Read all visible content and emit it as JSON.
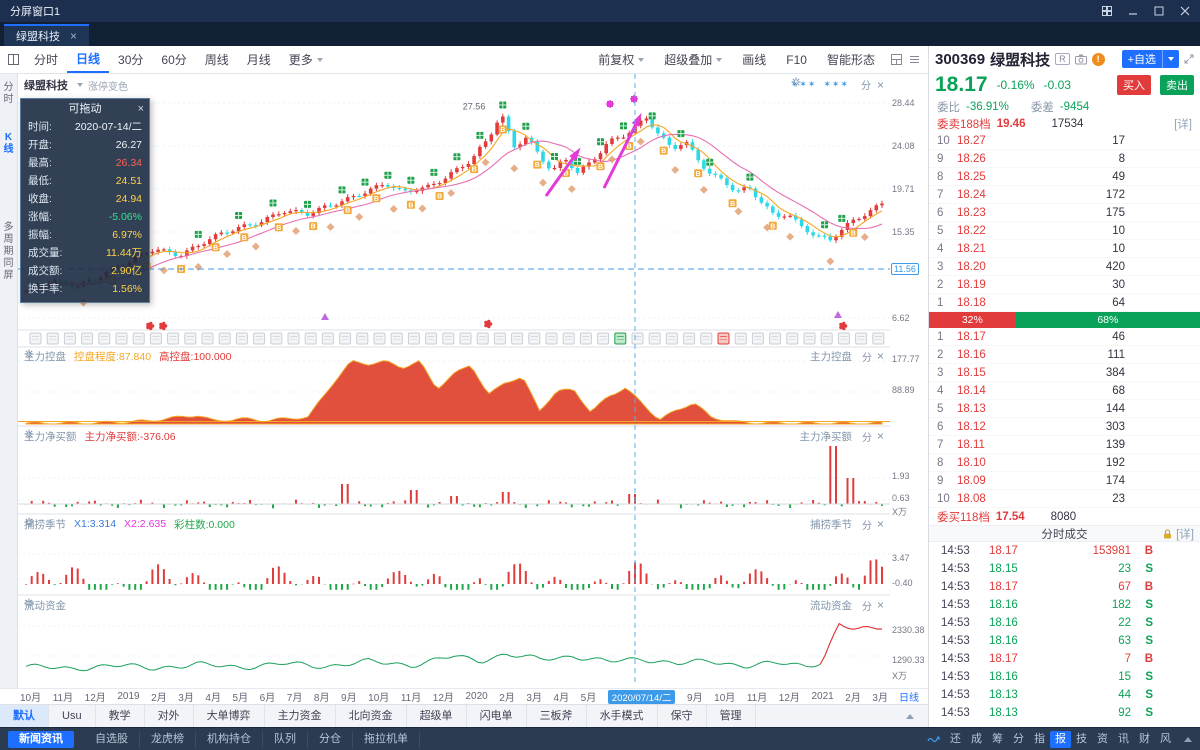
{
  "window": {
    "title": "分屏窗口1"
  },
  "doc_tab": {
    "label": "绿盟科技"
  },
  "ui": {
    "split_label": "分"
  },
  "toolbar": {
    "periods": [
      "分时",
      "日线",
      "30分",
      "60分",
      "周线",
      "月线"
    ],
    "active_period": "日线",
    "more": "更多",
    "right_items": [
      "前复权",
      "超级叠加",
      "画线",
      "F10",
      "智能形态"
    ]
  },
  "left_rail": {
    "top": "分时",
    "active": "K线",
    "bottom": "多周期同屏"
  },
  "chart_header": {
    "symbol_name": "绿盟科技",
    "option": "涨停变色"
  },
  "info_box": {
    "title": "可拖动",
    "rows": [
      {
        "label": "时间:",
        "value": "2020-07-14/二",
        "color": "white"
      },
      {
        "label": "开盘:",
        "value": "26.27",
        "color": "white"
      },
      {
        "label": "最高:",
        "value": "26.34",
        "color": "red"
      },
      {
        "label": "最低:",
        "value": "24.51",
        "color": "yellow"
      },
      {
        "label": "收盘:",
        "value": "24.94",
        "color": "yellow"
      },
      {
        "label": "涨幅:",
        "value": "-5.06%",
        "color": "green"
      },
      {
        "label": "振幅:",
        "value": "6.97%",
        "color": "yellow"
      },
      {
        "label": "成交量:",
        "value": "11.44万",
        "color": "yellow"
      },
      {
        "label": "成交额:",
        "value": "2.90亿",
        "color": "yellow"
      },
      {
        "label": "换手率:",
        "value": "1.56%",
        "color": "yellow"
      }
    ]
  },
  "main_chart": {
    "peak_label": "27.56",
    "y_axis": [
      "28.44",
      "24.08",
      "19.71",
      "15.35",
      "11.56",
      "6.62"
    ]
  },
  "panels": [
    {
      "name": "主力控盘",
      "stats": [
        {
          "text": "控盘程度:87.840",
          "color": "#f5a623"
        },
        {
          "text": "高控盘:100.000",
          "color": "#e23b3b"
        }
      ],
      "axis": [
        "177.77",
        "88.89"
      ]
    },
    {
      "name": "主力净买额",
      "stats": [
        {
          "text": "主力净买额:-376.06",
          "color": "#e23b3b"
        }
      ],
      "axis": [
        "1.93",
        "0.63",
        "X万"
      ]
    },
    {
      "name": "捕捞季节",
      "stats": [
        {
          "text": "X1:3.314",
          "color": "#3a7bd5"
        },
        {
          "text": "X2:2.635",
          "color": "#e837e8"
        },
        {
          "text": "彩柱数:0.000",
          "color": "#1fa84a"
        }
      ],
      "axis": [
        "3.47",
        "-0.40"
      ]
    },
    {
      "name": "流动资金",
      "stats": [],
      "axis": [
        "2330.38",
        "1290.33",
        "X万"
      ]
    }
  ],
  "x_axis": {
    "labels": [
      "10月",
      "11月",
      "12月",
      "2019",
      "2月",
      "3月",
      "4月",
      "5月",
      "6月",
      "7月",
      "8月",
      "9月",
      "10月",
      "11月",
      "12月",
      "2020",
      "2月",
      "3月",
      "4月",
      "5月"
    ],
    "crosshair_label": "2020/07/14/二",
    "labels_after": [
      "9月",
      "10月",
      "11月",
      "12月",
      "2021",
      "2月",
      "3月"
    ],
    "period_label": "日线"
  },
  "bottom_tabs": {
    "items": [
      "默认",
      "Usu",
      "教学",
      "对外",
      "大单博弈",
      "主力资金",
      "北向资金",
      "超级单",
      "闪电单",
      "三板斧",
      "水手模式",
      "保守",
      "管理"
    ],
    "active": "默认"
  },
  "status_bar": {
    "left_items": [
      "新闻资讯",
      "自选股",
      "龙虎榜",
      "机构持仓",
      "队列",
      "分仓",
      "拖拉机单"
    ],
    "active_left": "新闻资讯",
    "right_items": [
      "还",
      "成",
      "筹",
      "分",
      "指",
      "报",
      "技",
      "资",
      "讯",
      "财",
      "风"
    ],
    "active_right": "报"
  },
  "quote_panel": {
    "code": "300369",
    "name": "绿盟科技",
    "badge_r": "R",
    "add_watch": "+自选",
    "price": "18.17",
    "change_pct": "-0.16%",
    "change": "-0.03",
    "buy_btn": "买入",
    "sell_btn": "卖出",
    "weibi_label": "委比",
    "weibi": "-36.91%",
    "weicha_label": "委差",
    "weicha": "-9454",
    "sell_summary": {
      "label": "委卖188档",
      "price": "19.46",
      "vol": "17534",
      "detail": "[详]"
    },
    "buy_summary": {
      "label": "委买118档",
      "price": "17.54",
      "vol": "8080"
    },
    "sell_levels": [
      {
        "n": "10",
        "price": "18.27",
        "vol": "17"
      },
      {
        "n": "9",
        "price": "18.26",
        "vol": "8"
      },
      {
        "n": "8",
        "price": "18.25",
        "vol": "49"
      },
      {
        "n": "7",
        "price": "18.24",
        "vol": "172"
      },
      {
        "n": "6",
        "price": "18.23",
        "vol": "175"
      },
      {
        "n": "5",
        "price": "18.22",
        "vol": "10"
      },
      {
        "n": "4",
        "price": "18.21",
        "vol": "10"
      },
      {
        "n": "3",
        "price": "18.20",
        "vol": "420"
      },
      {
        "n": "2",
        "price": "18.19",
        "vol": "30"
      },
      {
        "n": "1",
        "price": "18.18",
        "vol": "64"
      }
    ],
    "ratio_bar": {
      "red_pct": 32,
      "red_label": "32%",
      "green_label": "68%"
    },
    "buy_levels": [
      {
        "n": "1",
        "price": "18.17",
        "vol": "46"
      },
      {
        "n": "2",
        "price": "18.16",
        "vol": "111"
      },
      {
        "n": "3",
        "price": "18.15",
        "vol": "384"
      },
      {
        "n": "4",
        "price": "18.14",
        "vol": "68"
      },
      {
        "n": "5",
        "price": "18.13",
        "vol": "144"
      },
      {
        "n": "6",
        "price": "18.12",
        "vol": "303"
      },
      {
        "n": "7",
        "price": "18.11",
        "vol": "139"
      },
      {
        "n": "8",
        "price": "18.10",
        "vol": "192"
      },
      {
        "n": "9",
        "price": "18.09",
        "vol": "174"
      },
      {
        "n": "10",
        "price": "18.08",
        "vol": "23"
      }
    ],
    "tick_header": {
      "title": "分时成交",
      "detail": "[详]"
    },
    "ticks": [
      {
        "time": "14:53",
        "price": "18.17",
        "vol": "153981",
        "side": "B"
      },
      {
        "time": "14:53",
        "price": "18.15",
        "vol": "23",
        "side": "S"
      },
      {
        "time": "14:53",
        "price": "18.17",
        "vol": "67",
        "side": "B"
      },
      {
        "time": "14:53",
        "price": "18.16",
        "vol": "182",
        "side": "S"
      },
      {
        "time": "14:53",
        "price": "18.16",
        "vol": "22",
        "side": "S"
      },
      {
        "time": "14:53",
        "price": "18.16",
        "vol": "63",
        "side": "S"
      },
      {
        "time": "14:53",
        "price": "18.17",
        "vol": "7",
        "side": "B"
      },
      {
        "time": "14:53",
        "price": "18.16",
        "vol": "15",
        "side": "S"
      },
      {
        "time": "14:53",
        "price": "18.13",
        "vol": "44",
        "side": "S"
      },
      {
        "time": "14:53",
        "price": "18.13",
        "vol": "92",
        "side": "S"
      }
    ]
  },
  "chart_data": {
    "type": "candlestick",
    "title": "绿盟科技 日线",
    "price_range": [
      6.62,
      28.44
    ],
    "n_candles": 150,
    "price_anchors": [
      [
        0,
        9.4
      ],
      [
        0.03,
        10.2
      ],
      [
        0.06,
        10.0
      ],
      [
        0.09,
        11.2
      ],
      [
        0.12,
        12.2
      ],
      [
        0.15,
        13.6
      ],
      [
        0.18,
        13.2
      ],
      [
        0.21,
        14.4
      ],
      [
        0.24,
        15.4
      ],
      [
        0.27,
        16.4
      ],
      [
        0.3,
        17.6
      ],
      [
        0.33,
        17.0
      ],
      [
        0.36,
        18.2
      ],
      [
        0.39,
        19.4
      ],
      [
        0.42,
        20.2
      ],
      [
        0.44,
        19.2
      ],
      [
        0.47,
        20.0
      ],
      [
        0.5,
        21.6
      ],
      [
        0.52,
        22.6
      ],
      [
        0.54,
        24.6
      ],
      [
        0.555,
        27.3
      ],
      [
        0.57,
        24.0
      ],
      [
        0.585,
        25.2
      ],
      [
        0.6,
        23.2
      ],
      [
        0.615,
        21.6
      ],
      [
        0.63,
        22.6
      ],
      [
        0.645,
        21.2
      ],
      [
        0.66,
        22.3
      ],
      [
        0.68,
        24.6
      ],
      [
        0.7,
        25.4
      ],
      [
        0.725,
        26.9
      ],
      [
        0.74,
        25.0
      ],
      [
        0.755,
        23.6
      ],
      [
        0.77,
        24.6
      ],
      [
        0.785,
        22.8
      ],
      [
        0.8,
        21.4
      ],
      [
        0.815,
        20.6
      ],
      [
        0.83,
        19.4
      ],
      [
        0.845,
        19.6
      ],
      [
        0.86,
        18.2
      ],
      [
        0.875,
        16.9
      ],
      [
        0.89,
        17.4
      ],
      [
        0.905,
        16.1
      ],
      [
        0.925,
        14.9
      ],
      [
        0.94,
        14.4
      ],
      [
        0.955,
        15.6
      ],
      [
        0.97,
        16.6
      ],
      [
        1,
        18.4
      ]
    ],
    "markers": {
      "green_idx": [
        30,
        37,
        43,
        49,
        55,
        59,
        63,
        67,
        71,
        75,
        79,
        83,
        87,
        92,
        96,
        100,
        104,
        109,
        114,
        119,
        126,
        139,
        142
      ],
      "b_idx": [
        15,
        21,
        27,
        33,
        38,
        44,
        50,
        56,
        61,
        67,
        72,
        78,
        83,
        89,
        94,
        100,
        105,
        111,
        117,
        123,
        130,
        144
      ],
      "diamond_idx": [
        10,
        17,
        24,
        30,
        35,
        40,
        47,
        53,
        58,
        64,
        69,
        74,
        80,
        85,
        90,
        95,
        102,
        107,
        113,
        118,
        124,
        129,
        133,
        140,
        146
      ]
    },
    "panel1_anchors": [
      [
        0,
        2
      ],
      [
        0.08,
        3
      ],
      [
        0.14,
        8
      ],
      [
        0.2,
        25
      ],
      [
        0.22,
        8
      ],
      [
        0.25,
        15
      ],
      [
        0.28,
        10
      ],
      [
        0.33,
        20
      ],
      [
        0.36,
        120
      ],
      [
        0.38,
        176
      ],
      [
        0.4,
        170
      ],
      [
        0.42,
        176
      ],
      [
        0.44,
        160
      ],
      [
        0.46,
        176
      ],
      [
        0.48,
        100
      ],
      [
        0.5,
        140
      ],
      [
        0.52,
        170
      ],
      [
        0.54,
        80
      ],
      [
        0.56,
        120
      ],
      [
        0.58,
        130
      ],
      [
        0.6,
        40
      ],
      [
        0.62,
        90
      ],
      [
        0.64,
        100
      ],
      [
        0.66,
        30
      ],
      [
        0.68,
        80
      ],
      [
        0.7,
        100
      ],
      [
        0.72,
        60
      ],
      [
        0.74,
        10
      ],
      [
        0.76,
        40
      ],
      [
        0.78,
        60
      ],
      [
        0.8,
        20
      ],
      [
        0.83,
        5
      ],
      [
        0.86,
        3
      ],
      [
        0.9,
        2
      ],
      [
        0.95,
        2
      ],
      [
        1,
        2
      ]
    ],
    "panel2_spikes": [
      [
        0.37,
        20
      ],
      [
        0.45,
        14
      ],
      [
        0.5,
        8
      ],
      [
        0.56,
        12
      ],
      [
        0.71,
        10
      ],
      [
        0.94,
        58
      ],
      [
        0.965,
        26
      ]
    ],
    "panel3_bursts": [
      [
        0.545,
        2.4
      ],
      [
        0.975,
        2.6
      ]
    ],
    "fund_anchors": [
      [
        0,
        1320
      ],
      [
        0.05,
        1260
      ],
      [
        0.1,
        1340
      ],
      [
        0.15,
        1280
      ],
      [
        0.2,
        1360
      ],
      [
        0.25,
        1300
      ],
      [
        0.3,
        1380
      ],
      [
        0.35,
        1320
      ],
      [
        0.4,
        1430
      ],
      [
        0.45,
        1350
      ],
      [
        0.5,
        1550
      ],
      [
        0.53,
        1450
      ],
      [
        0.56,
        1600
      ],
      [
        0.6,
        1480
      ],
      [
        0.64,
        1560
      ],
      [
        0.68,
        1420
      ],
      [
        0.72,
        1500
      ],
      [
        0.76,
        1380
      ],
      [
        0.8,
        1440
      ],
      [
        0.84,
        1330
      ],
      [
        0.88,
        1390
      ],
      [
        0.91,
        1340
      ],
      [
        0.93,
        1420
      ],
      [
        0.95,
        2300
      ],
      [
        0.97,
        2150
      ],
      [
        1,
        2250
      ]
    ]
  }
}
